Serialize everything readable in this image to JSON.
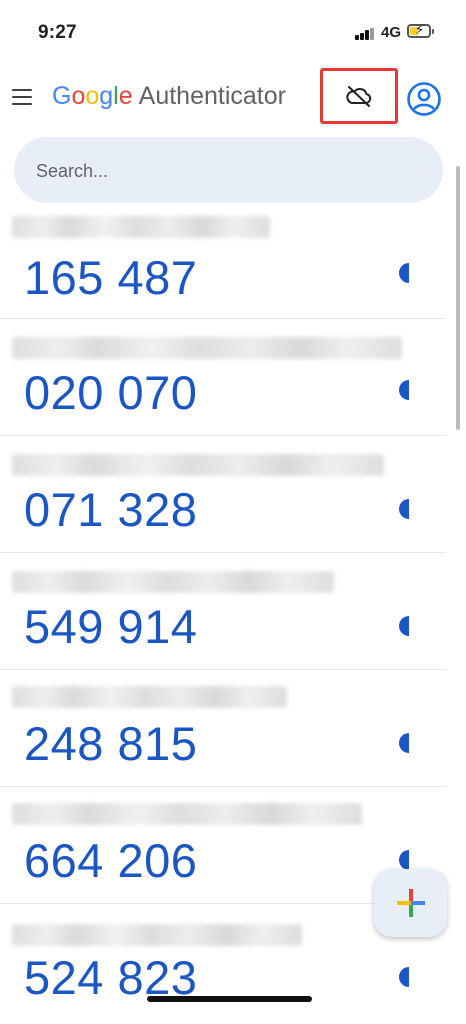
{
  "status_bar": {
    "time": "9:27",
    "network": "4G"
  },
  "app_bar": {
    "logo_letters": [
      "G",
      "o",
      "o",
      "g",
      "l",
      "e"
    ],
    "title_rest": "Authenticator",
    "icons": {
      "menu": "menu-icon",
      "cloud": "cloud-off-icon",
      "account": "account-circle-icon"
    }
  },
  "search": {
    "placeholder": "Search...",
    "value": ""
  },
  "codes": [
    {
      "code": "165 487",
      "account_label_visible": "blurred"
    },
    {
      "code": "020 070",
      "account_label_visible": "blurred"
    },
    {
      "code": "071 328",
      "account_label_visible": "blurred"
    },
    {
      "code": "549 914",
      "account_label_visible": "blurred"
    },
    {
      "code": "248 815",
      "account_label_visible": "blurred"
    },
    {
      "code": "664 206",
      "account_label_visible": "blurred"
    },
    {
      "code": "524 823",
      "account_label_visible": "blurred"
    }
  ],
  "timer_remaining_fraction": 0.5,
  "colors": {
    "code_blue": "#1a56c4",
    "google_blue": "#4285F4",
    "google_red": "#EA4335",
    "google_yellow": "#FBBC05",
    "google_green": "#34A853",
    "highlight_red": "#e53935",
    "search_bg": "#e8eef7"
  }
}
